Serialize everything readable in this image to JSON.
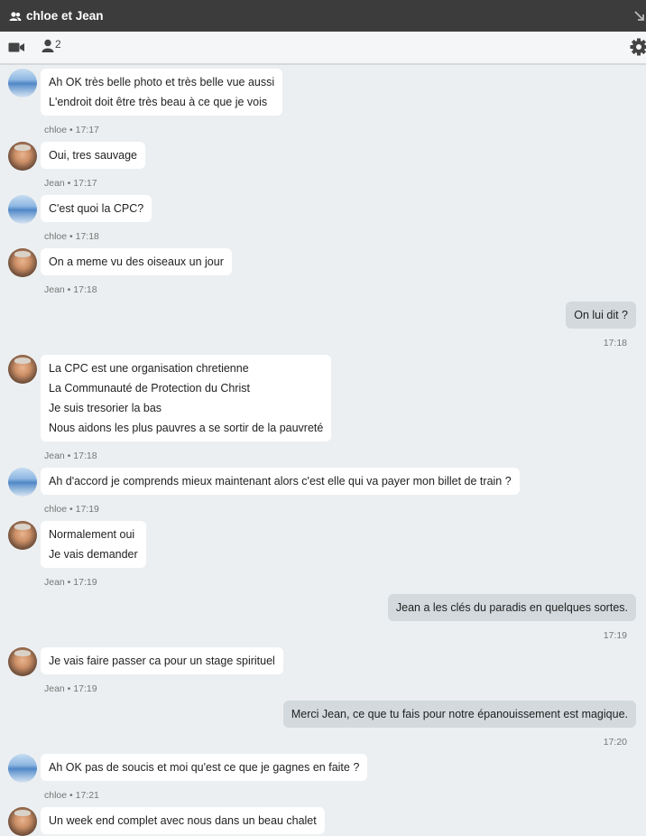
{
  "window": {
    "title": "chloe et Jean"
  },
  "toolbar": {
    "participant_count": "2"
  },
  "messages": [
    {
      "author": "chloe",
      "lines": [
        "Ah OK très belle photo et très belle vue aussi",
        "L'endroit doit être très beau à ce que je vois"
      ],
      "meta": "chloe • 17:17"
    },
    {
      "author": "jean",
      "lines": [
        "Oui, tres sauvage"
      ],
      "meta": "Jean • 17:17"
    },
    {
      "author": "chloe",
      "lines": [
        "C'est quoi la CPC?"
      ],
      "meta": "chloe • 17:18"
    },
    {
      "author": "jean",
      "lines": [
        "On a meme vu des oiseaux un jour"
      ],
      "meta": "Jean • 17:18"
    },
    {
      "author": "me",
      "lines": [
        "On lui dit ?"
      ],
      "meta": "17:18"
    },
    {
      "author": "jean",
      "lines": [
        "La CPC est une organisation chretienne",
        "La Communauté de Protection du Christ",
        "Je suis tresorier la bas",
        "Nous aidons les plus pauvres a se sortir de la pauvreté"
      ],
      "meta": "Jean • 17:18"
    },
    {
      "author": "chloe",
      "lines": [
        "Ah d'accord je comprends mieux maintenant alors c'est elle qui va payer mon billet de train ?"
      ],
      "meta": "chloe • 17:19"
    },
    {
      "author": "jean",
      "lines": [
        "Normalement oui",
        "Je vais demander"
      ],
      "meta": "Jean • 17:19"
    },
    {
      "author": "me",
      "lines": [
        "Jean a les clés du paradis en quelques sortes."
      ],
      "meta": "17:19"
    },
    {
      "author": "jean",
      "lines": [
        "Je vais faire passer ca pour un stage spirituel"
      ],
      "meta": "Jean • 17:19"
    },
    {
      "author": "me",
      "lines": [
        "Merci Jean, ce que tu fais pour notre épanouissement est magique."
      ],
      "meta": "17:20"
    },
    {
      "author": "chloe",
      "lines": [
        "Ah OK pas de soucis et moi qu'est ce que je gagnes en faite ?"
      ],
      "meta": "chloe • 17:21"
    },
    {
      "author": "jean",
      "lines": [
        "Un week end complet avec nous dans un beau chalet"
      ],
      "meta": ""
    }
  ],
  "colors": {
    "titlebar": "#3c3c3c",
    "background": "#eceff1",
    "bubble_in": "#ffffff",
    "bubble_out": "#d3d9dd",
    "meta_text": "#757575"
  },
  "icons": {
    "title": "users-icon",
    "video": "video-camera-icon",
    "participants": "user-icon",
    "settings": "gear-icon",
    "window": "collapse-arrow-icon"
  }
}
